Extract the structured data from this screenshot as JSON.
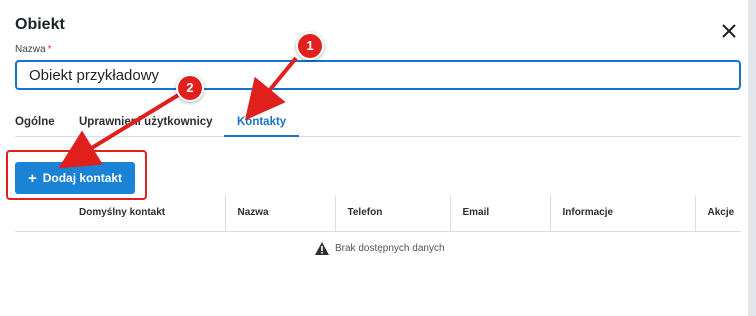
{
  "dialog": {
    "title": "Obiekt",
    "close_label": "close"
  },
  "form": {
    "name_label": "Nazwa",
    "required_mark": "*",
    "name_value": "Obiekt przykładowy"
  },
  "tabs": [
    {
      "label": "Ogólne",
      "active": false
    },
    {
      "label": "Uprawnieni użytkownicy",
      "active": false
    },
    {
      "label": "Kontakty",
      "active": true
    }
  ],
  "contacts": {
    "add_button_label": "Dodaj kontakt",
    "columns": [
      "Domyślny kontakt",
      "Nazwa",
      "Telefon",
      "Email",
      "Informacje",
      "Akcje"
    ],
    "empty_text": "Brak dostępnych danych"
  },
  "annotations": [
    {
      "number": "1",
      "target": "tab-kontakty"
    },
    {
      "number": "2",
      "target": "add-contact-button"
    }
  ],
  "colors": {
    "accent": "#1a73c8",
    "button": "#1a83d6",
    "annotation": "#e0201d"
  }
}
